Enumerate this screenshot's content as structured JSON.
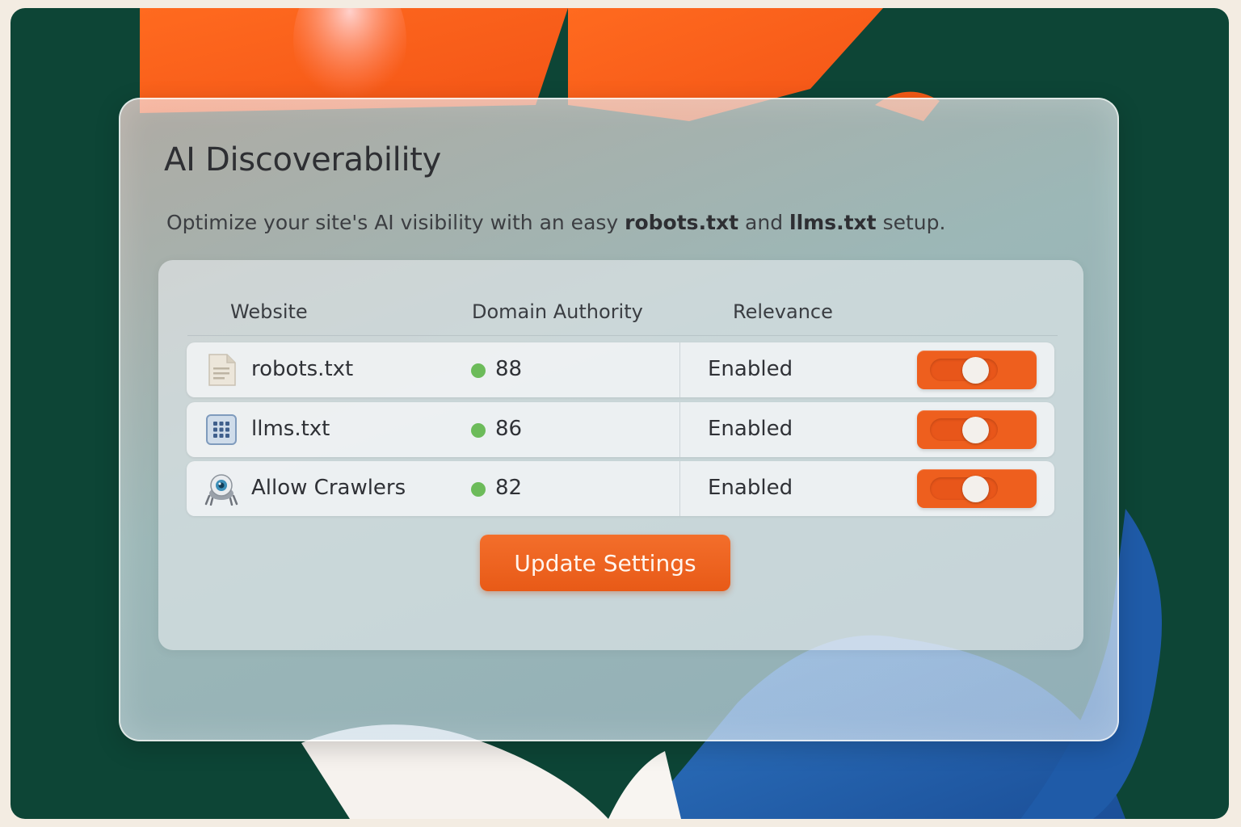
{
  "header": {
    "title": "AI Discoverability",
    "subtitle_pre": "Optimize your site's AI visibility with an easy ",
    "subtitle_bold1": "robots.txt",
    "subtitle_mid": " and ",
    "subtitle_bold2": "llms.txt",
    "subtitle_post": " setup."
  },
  "table": {
    "columns": [
      "Website",
      "Domain Authority",
      "Relevance"
    ],
    "rows": [
      {
        "name": "robots.txt",
        "score": "88",
        "status": "Enabled",
        "icon": "document-icon",
        "enabled": true
      },
      {
        "name": "llms.txt",
        "score": "86",
        "status": "Enabled",
        "icon": "grid-icon",
        "enabled": true
      },
      {
        "name": "Allow Crawlers",
        "score": "82",
        "status": "Enabled",
        "icon": "robot-crawler-icon",
        "enabled": true
      }
    ]
  },
  "actions": {
    "update_label": "Update Settings"
  },
  "colors": {
    "accent": "#ee5f1e",
    "status_dot": "#6cbb5a",
    "background": "#0d4536"
  }
}
